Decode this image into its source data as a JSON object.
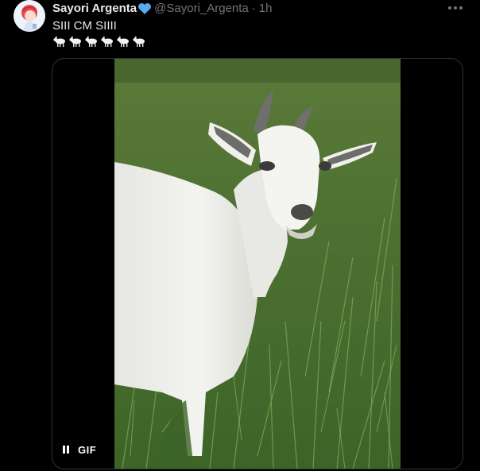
{
  "tweet": {
    "author": {
      "display_name": "Sayori Argenta",
      "handle": "@Sayori_Argenta",
      "verified_emoji": "blue-heart-icon"
    },
    "separator": "·",
    "timestamp": "1h",
    "text_line_1": "SIII CM SIIII",
    "emoji_line": [
      "goat-emoji",
      "goat-emoji",
      "goat-emoji",
      "goat-emoji",
      "goat-emoji",
      "goat-emoji"
    ],
    "media": {
      "type": "gif",
      "badge": "GIF",
      "playback_control": "pause-icon"
    }
  },
  "colors": {
    "background": "#000000",
    "primary_text": "#e7e9ea",
    "secondary_text": "#71767b",
    "border": "#2f3336",
    "heart": "#5aa9f0"
  }
}
